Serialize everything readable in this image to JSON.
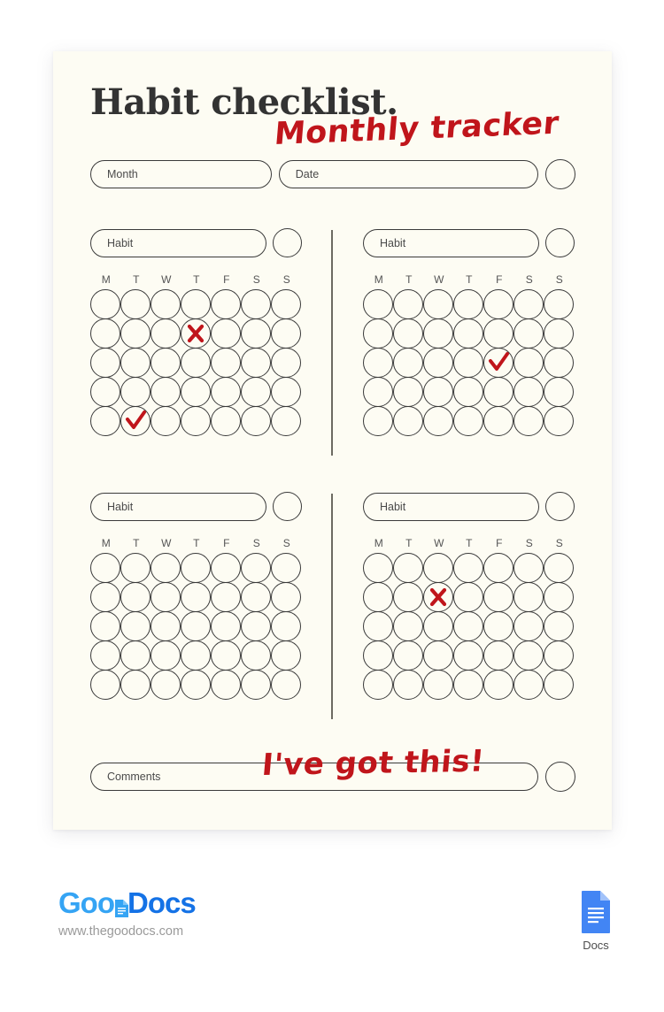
{
  "document": {
    "title": "Habit checklist.",
    "subtitle_handwritten": "Monthly tracker",
    "accent_red": "#c0151b",
    "paper_color": "#fdfcf3",
    "ink_color": "#333333"
  },
  "header_fields": {
    "month_label": "Month",
    "date_label": "Date"
  },
  "day_labels": [
    "M",
    "T",
    "W",
    "T",
    "F",
    "S",
    "S"
  ],
  "grid": {
    "columns": 7,
    "rows": 5
  },
  "habits": [
    {
      "position": "top-left",
      "label": "Habit",
      "marks": [
        {
          "row": 2,
          "col": 4,
          "type": "x"
        },
        {
          "row": 5,
          "col": 2,
          "type": "check"
        }
      ]
    },
    {
      "position": "top-right",
      "label": "Habit",
      "marks": [
        {
          "row": 3,
          "col": 5,
          "type": "check"
        }
      ]
    },
    {
      "position": "bottom-left",
      "label": "Habit",
      "marks": []
    },
    {
      "position": "bottom-right",
      "label": "Habit",
      "marks": [
        {
          "row": 2,
          "col": 3,
          "type": "x"
        }
      ]
    }
  ],
  "comments": {
    "label": "Comments",
    "handwritten_note": "I've got this!"
  },
  "footer": {
    "brand_part1": "Goo",
    "brand_part2": "Docs",
    "url": "www.thegoodocs.com",
    "docs_caption": "Docs",
    "brand_blue_light": "#35a4f4",
    "brand_blue_dark": "#1472e6",
    "docs_icon_color": "#4285f4"
  }
}
